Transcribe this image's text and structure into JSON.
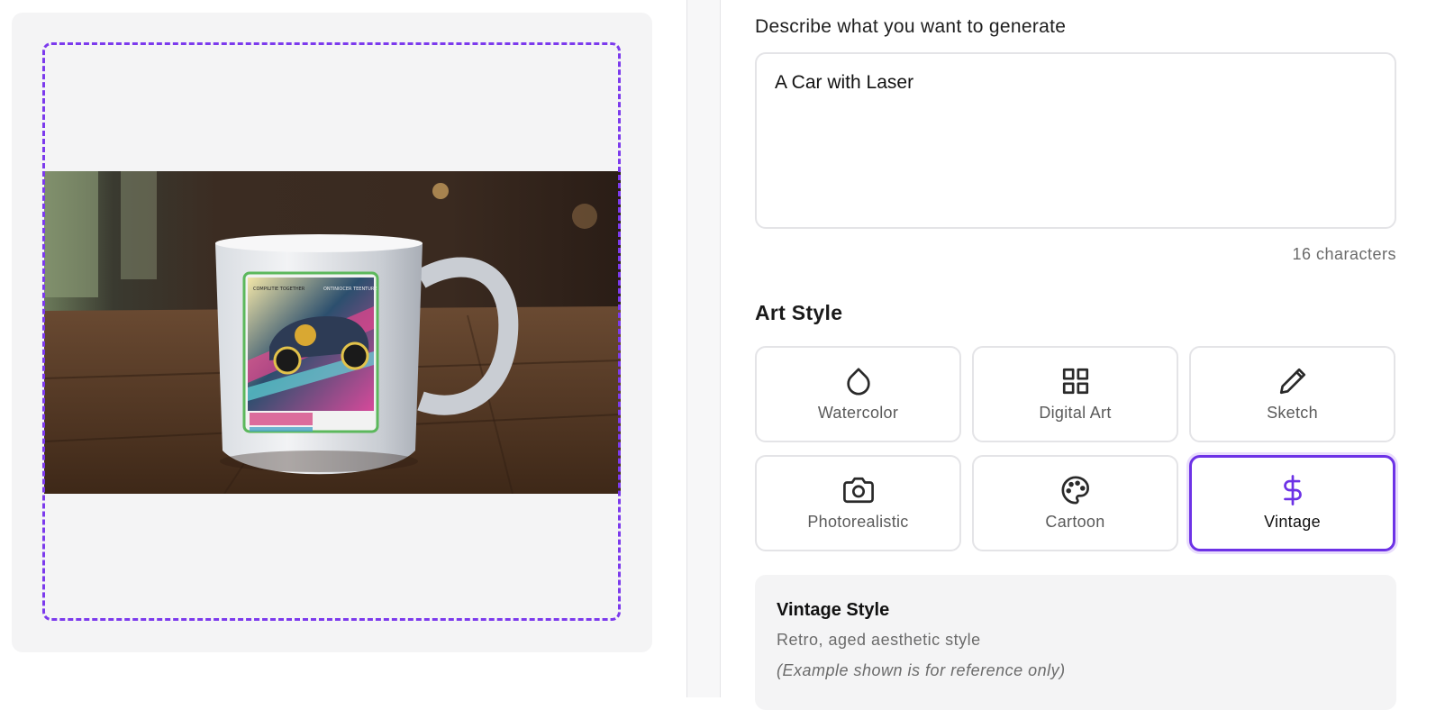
{
  "prompt": {
    "label": "Describe what you want to generate",
    "value": "A Car with Laser",
    "char_count": "16 characters"
  },
  "art_style": {
    "title": "Art Style",
    "options": [
      {
        "label": "Watercolor",
        "icon": "droplet-icon"
      },
      {
        "label": "Digital Art",
        "icon": "grid-icon"
      },
      {
        "label": "Sketch",
        "icon": "pencil-icon"
      },
      {
        "label": "Photorealistic",
        "icon": "camera-icon"
      },
      {
        "label": "Cartoon",
        "icon": "palette-icon"
      },
      {
        "label": "Vintage",
        "icon": "dollar-icon"
      }
    ],
    "selected": "Vintage",
    "accent_color": "#6d32e6"
  },
  "style_info": {
    "title": "Vintage Style",
    "description": "Retro, aged aesthetic style",
    "note": "(Example shown is for reference only)"
  },
  "preview": {
    "print_area_color": "#7c3aed",
    "design_frame_color": "#5cb85c",
    "design_text_left": "COMPILITIE TOGETHER",
    "design_text_right": "ONTINIOCER TEENTURE"
  }
}
